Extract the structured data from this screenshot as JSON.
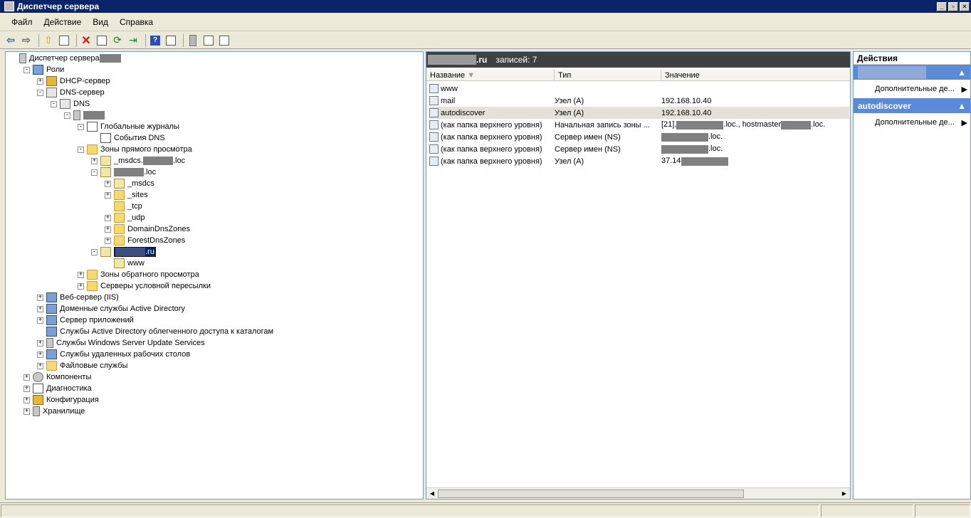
{
  "window": {
    "title": "Диспетчер сервера"
  },
  "menu": [
    "Файл",
    "Действие",
    "Вид",
    "Справка"
  ],
  "toolbar": [
    "back-icon",
    "forward-icon",
    "up-icon",
    "show-tree-icon",
    "delete-icon",
    "properties-icon",
    "refresh-icon",
    "export-icon",
    "help-icon",
    "view-icon",
    "server-icon",
    "list-icon",
    "copy-icon"
  ],
  "tree": [
    {
      "label": "Диспетчер сервера",
      "indent": 0,
      "exp": "",
      "icon": "srv",
      "redact": true
    },
    {
      "label": "Роли",
      "indent": 1,
      "exp": "−",
      "icon": "role"
    },
    {
      "label": "DHCP-сервер",
      "indent": 2,
      "exp": "+",
      "icon": "dhcp"
    },
    {
      "label": "DNS-сервер",
      "indent": 2,
      "exp": "−",
      "icon": "dns"
    },
    {
      "label": "DNS",
      "indent": 3,
      "exp": "−",
      "icon": "dns"
    },
    {
      "label": "",
      "indent": 4,
      "exp": "−",
      "icon": "srv",
      "redact": true
    },
    {
      "label": "Глобальные журналы",
      "indent": 5,
      "exp": "−",
      "icon": "log"
    },
    {
      "label": "События DNS",
      "indent": 6,
      "exp": "",
      "icon": "log"
    },
    {
      "label": "Зоны прямого просмотра",
      "indent": 5,
      "exp": "−",
      "icon": "folder"
    },
    {
      "label": "_msdcs.",
      "indent": 6,
      "exp": "+",
      "icon": "zone",
      "redact": true,
      "suffix": ".loc"
    },
    {
      "label": "",
      "indent": 6,
      "exp": "−",
      "icon": "zone",
      "redact": true,
      "suffix": ".loc"
    },
    {
      "label": "_msdcs",
      "indent": 7,
      "exp": "+",
      "icon": "zone"
    },
    {
      "label": "_sites",
      "indent": 7,
      "exp": "+",
      "icon": "folder"
    },
    {
      "label": "_tcp",
      "indent": 7,
      "exp": "",
      "icon": "folder"
    },
    {
      "label": "_udp",
      "indent": 7,
      "exp": "+",
      "icon": "folder"
    },
    {
      "label": "DomainDnsZones",
      "indent": 7,
      "exp": "+",
      "icon": "folder"
    },
    {
      "label": "ForestDnsZones",
      "indent": 7,
      "exp": "+",
      "icon": "folder"
    },
    {
      "label": "",
      "indent": 6,
      "exp": "−",
      "icon": "zone",
      "redact": true,
      "suffix": ".ru",
      "selected": true
    },
    {
      "label": "www",
      "indent": 7,
      "exp": "",
      "icon": "zone"
    },
    {
      "label": "Зоны обратного просмотра",
      "indent": 5,
      "exp": "+",
      "icon": "folder"
    },
    {
      "label": "Серверы условной пересылки",
      "indent": 5,
      "exp": "+",
      "icon": "folder"
    },
    {
      "label": "Веб-сервер (IIS)",
      "indent": 2,
      "exp": "+",
      "icon": "role"
    },
    {
      "label": "Доменные службы Active Directory",
      "indent": 2,
      "exp": "+",
      "icon": "role"
    },
    {
      "label": "Сервер приложений",
      "indent": 2,
      "exp": "+",
      "icon": "role"
    },
    {
      "label": "Службы Active Directory облегченного доступа к каталогам",
      "indent": 2,
      "exp": "",
      "icon": "role"
    },
    {
      "label": "Службы Windows Server Update Services",
      "indent": 2,
      "exp": "+",
      "icon": "srv"
    },
    {
      "label": "Службы удаленных рабочих столов",
      "indent": 2,
      "exp": "+",
      "icon": "role"
    },
    {
      "label": "Файловые службы",
      "indent": 2,
      "exp": "+",
      "icon": "folder"
    },
    {
      "label": "Компоненты",
      "indent": 1,
      "exp": "+",
      "icon": "gear"
    },
    {
      "label": "Диагностика",
      "indent": 1,
      "exp": "+",
      "icon": "log"
    },
    {
      "label": "Конфигурация",
      "indent": 1,
      "exp": "+",
      "icon": "dhcp"
    },
    {
      "label": "Хранилище",
      "indent": 1,
      "exp": "+",
      "icon": "srv"
    }
  ],
  "list": {
    "header_suffix": ".ru",
    "records_label": "записей: 7",
    "columns": [
      "Название",
      "Тип",
      "Значение"
    ],
    "rows": [
      {
        "name": "www",
        "type": "",
        "value": ""
      },
      {
        "name": "mail",
        "type": "Узел (A)",
        "value": "192.168.10.40"
      },
      {
        "name": "autodiscover",
        "type": "Узел (A)",
        "value": "192.168.10.40",
        "selected": true
      },
      {
        "name": "(как папка верхнего уровня)",
        "type": "Начальная запись зоны ...",
        "value": "[21],",
        "redact": true,
        "value2": ".loc., hostmaster",
        "value3": ".loc."
      },
      {
        "name": "(как папка верхнего уровня)",
        "type": "Сервер имен (NS)",
        "value": "",
        "redact": true,
        "value2": ".loc."
      },
      {
        "name": "(как папка верхнего уровня)",
        "type": "Сервер имен (NS)",
        "value": "",
        "redact": true,
        "value2": ".loc."
      },
      {
        "name": "(как папка верхнего уровня)",
        "type": "Узел (A)",
        "value": "37.14",
        "redact": true
      }
    ]
  },
  "actions": {
    "title": "Действия",
    "sections": [
      {
        "label": "",
        "item": "Дополнительные де..."
      },
      {
        "label": "autodiscover",
        "item": "Дополнительные де..."
      }
    ]
  }
}
